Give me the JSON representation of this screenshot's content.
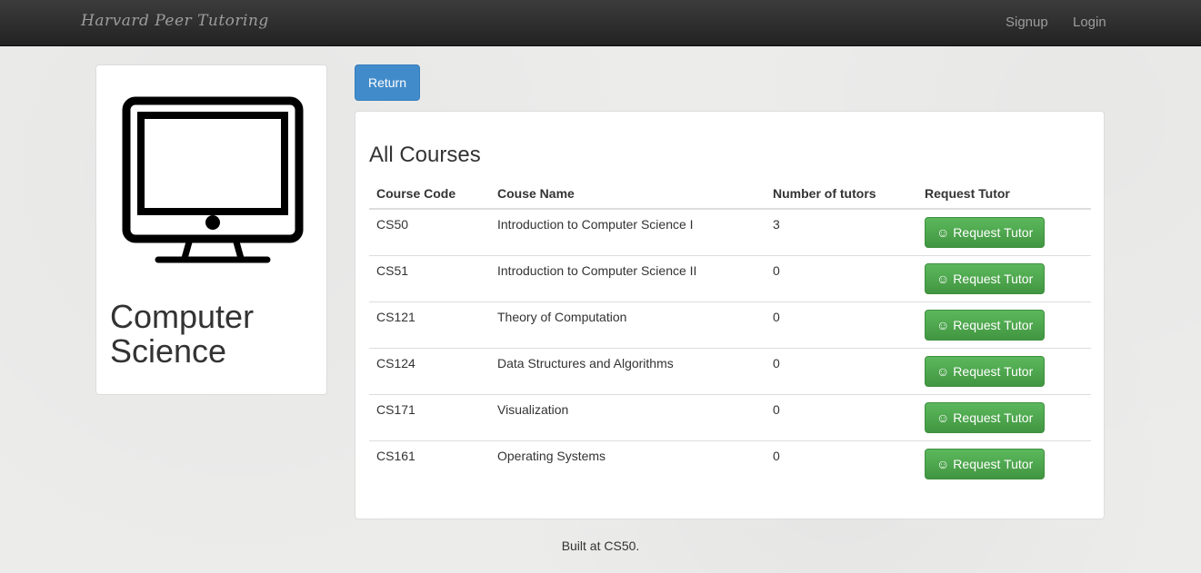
{
  "navbar": {
    "brand": "Harvard Peer Tutoring",
    "links": [
      "Signup",
      "Login"
    ]
  },
  "department": {
    "icon": "computer-monitor-icon",
    "title": "Computer Science"
  },
  "return_label": "Return",
  "courses": {
    "title": "All Courses",
    "headers": [
      "Course Code",
      "Couse Name",
      "Number of tutors",
      "Request Tutor"
    ],
    "rows": [
      {
        "code": "CS50",
        "name": "Introduction to Computer Science I",
        "tutors": "3",
        "action": "Request Tutor"
      },
      {
        "code": "CS51",
        "name": "Introduction to Computer Science II",
        "tutors": "0",
        "action": "Request Tutor"
      },
      {
        "code": "CS121",
        "name": "Theory of Computation",
        "tutors": "0",
        "action": "Request Tutor"
      },
      {
        "code": "CS124",
        "name": "Data Structures and Algorithms",
        "tutors": "0",
        "action": "Request Tutor"
      },
      {
        "code": "CS171",
        "name": "Visualization",
        "tutors": "0",
        "action": "Request Tutor"
      },
      {
        "code": "CS161",
        "name": "Operating Systems",
        "tutors": "0",
        "action": "Request Tutor"
      }
    ]
  },
  "footer": "Built at CS50.",
  "colors": {
    "primary": "#428bca",
    "success": "#5cb85c",
    "navbar": "#222222"
  }
}
